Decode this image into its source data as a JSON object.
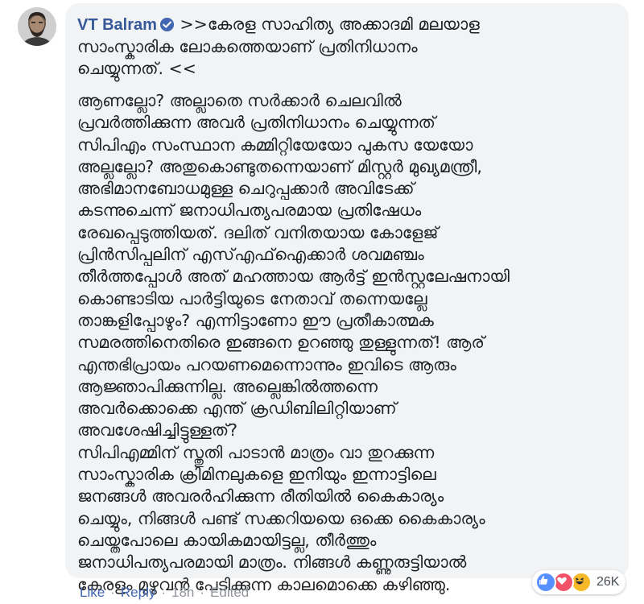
{
  "comment": {
    "author": "VT Balram",
    "quote": ">>കേരള സാഹിത്യ അക്കാദമി മലയാള\nസാംസ്കാരിക ലോകത്തെയാണ് പ്രതിനിധാനം\nചെയ്യുന്നത്. <<",
    "body": "ആണല്ലോ? അല്ലാതെ സർക്കാർ ചെലവിൽ\nപ്രവർത്തിക്കുന്ന അവർ പ്രതിനിധാനം ചെയ്യുന്നത്\nസിപിഎം സംസ്ഥാന കമ്മിറ്റിയേയോ പുകസ യേയോ\nഅല്ലല്ലോ? അതുകൊണ്ടുതന്നെയാണ് മിസ്റ്റർ മുഖ്യമന്ത്രീ,\nഅഭിമാനബോധമുള്ള ചെറുപ്പക്കാർ അവിടേക്ക്\nകടന്നുചെന്ന് ജനാധിപത്യപരമായ പ്രതിഷേധം\nരേഖപ്പെടുത്തിയത്. ദലിത് വനിതയായ കോളേജ്\nപ്രിൻസിപ്പലിന് എസ്എഫ്ഐക്കാർ ശവമഞ്ചം\nതീർത്തപ്പോൾ അത് മഹത്തായ ആർട്ട് ഇൻസ്റ്റലേഷനായി\nകൊണ്ടാടിയ പാർട്ടിയുടെ നേതാവ് തന്നെയല്ലേ\nതാങ്കളിപ്പോഴും? എന്നിട്ടാണോ ഈ പ്രതീകാത്മക\nസമരത്തിനെതിരെ ഇങ്ങനെ ഉറഞ്ഞു തുള്ളുന്നത്! ആര്\nഎന്തഭിപ്രായം പറയണമെന്നൊന്നും ഇവിടെ ആരും\nആജ്ഞാപിക്കുന്നില്ല. അല്ലെങ്കിൽത്തന്നെ\nഅവർക്കൊക്കെ എന്ത് ക്രഡിബിലിറ്റിയാണ്\nഅവശേഷിച്ചിട്ടുള്ളത്?\nസിപിഎമ്മിന് സ്തുതി പാടാൻ മാത്രം വാ തുറക്കുന്ന\nസാംസ്കാരിക ക്രിമിനലുകളെ ഇനിയും ഇന്നാട്ടിലെ\nജനങ്ങൾ അവരർഹിക്കുന്ന രീതിയിൽ കൈകാര്യം\nചെയ്യും, നിങ്ങൾ പണ്ട് സക്കറിയയെ ഒക്കെ കൈകാര്യം\nചെയ്തപോലെ കായികമായിട്ടല്ല, തീർത്തും\nജനാധിപത്യപരമായി മാത്രം. നിങ്ങൾ കണ്ണുരുട്ടിയാൽ\nകേരളം മുഴുവൻ പേടിക്കുന്ന കാലമൊക്കെ കഴിഞ്ഞു."
  },
  "actions": {
    "like": "Like",
    "reply": "Reply",
    "time": "18h",
    "edited": "Edited",
    "separator": "·"
  },
  "reactions": {
    "icons": [
      "like-icon",
      "love-icon",
      "haha-icon"
    ],
    "count": "26K"
  },
  "colors": {
    "author": "#365899",
    "link": "#4267b2",
    "muted": "#90949c",
    "bubble": "#f2f3f5",
    "like": "#5890ff",
    "love": "#f25268",
    "haha": "#f7b928"
  }
}
